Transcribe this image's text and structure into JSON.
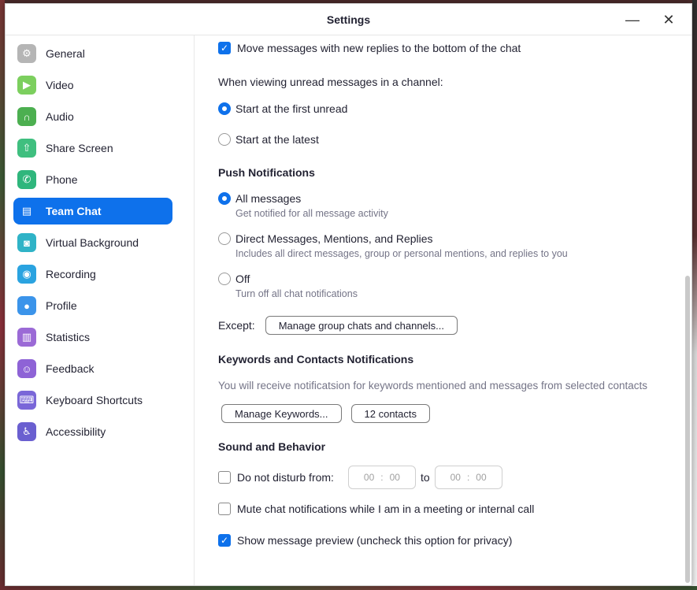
{
  "window": {
    "title": "Settings",
    "minimize_glyph": "—",
    "close_glyph": "✕"
  },
  "colors": {
    "accent": "#0e71eb",
    "muted": "#747487"
  },
  "sidebar": {
    "items": [
      {
        "label": "General",
        "icon": "gear-icon",
        "color": "#b5b5b5",
        "glyph": "⚙"
      },
      {
        "label": "Video",
        "icon": "video-camera-icon",
        "color": "#7ccf5e",
        "glyph": "▶"
      },
      {
        "label": "Audio",
        "icon": "headphones-icon",
        "color": "#4caf50",
        "glyph": "∩"
      },
      {
        "label": "Share Screen",
        "icon": "share-screen-icon",
        "color": "#3fbf7f",
        "glyph": "⇧"
      },
      {
        "label": "Phone",
        "icon": "phone-icon",
        "color": "#2fb67c",
        "glyph": "✆"
      },
      {
        "label": "Team Chat",
        "icon": "chat-bubble-icon",
        "color": "#0e71eb",
        "glyph": "▤"
      },
      {
        "label": "Virtual Background",
        "icon": "virtual-background-icon",
        "color": "#2fb3c7",
        "glyph": "◙"
      },
      {
        "label": "Recording",
        "icon": "recording-icon",
        "color": "#2aa3e0",
        "glyph": "◉"
      },
      {
        "label": "Profile",
        "icon": "profile-icon",
        "color": "#3b94ea",
        "glyph": "●"
      },
      {
        "label": "Statistics",
        "icon": "statistics-icon",
        "color": "#9b6ad6",
        "glyph": "▥"
      },
      {
        "label": "Feedback",
        "icon": "feedback-icon",
        "color": "#8e63d6",
        "glyph": "☺"
      },
      {
        "label": "Keyboard Shortcuts",
        "icon": "keyboard-icon",
        "color": "#7a67d8",
        "glyph": "⌨"
      },
      {
        "label": "Accessibility",
        "icon": "accessibility-icon",
        "color": "#6a5fd0",
        "glyph": "♿"
      }
    ],
    "active": "Team Chat"
  },
  "content": {
    "move_messages": {
      "label": "Move messages with new replies to the bottom of the chat",
      "checked": true
    },
    "unread_heading": "When viewing unread messages in a channel:",
    "unread_options": [
      {
        "label": "Start at the first unread",
        "checked": true
      },
      {
        "label": "Start at the latest",
        "checked": false
      }
    ],
    "push": {
      "heading": "Push Notifications",
      "options": [
        {
          "label": "All messages",
          "sub": "Get notified for all message activity",
          "checked": true
        },
        {
          "label": "Direct Messages, Mentions, and Replies",
          "sub": "Includes all direct messages, group or personal mentions, and replies to you",
          "checked": false
        },
        {
          "label": "Off",
          "sub": "Turn off all chat notifications",
          "checked": false
        }
      ],
      "except_label": "Except:",
      "manage_group_button": "Manage group chats and channels..."
    },
    "keywords": {
      "heading": "Keywords and Contacts Notifications",
      "description": "You will receive notificatsion for keywords mentioned and messages from selected contacts",
      "manage_keywords_button": "Manage Keywords...",
      "contacts_button": "12 contacts"
    },
    "sound": {
      "heading": "Sound and Behavior",
      "dnd_label": "Do not disturb from:",
      "dnd_from": {
        "hh": "00",
        "mm": "00"
      },
      "to_label": "to",
      "dnd_to": {
        "hh": "00",
        "mm": "00"
      },
      "time_separator": ":",
      "mute_label": "Mute chat notifications while I am in a meeting or internal call",
      "preview_label": "Show message preview (uncheck this option for privacy)",
      "dnd_checked": false,
      "mute_checked": false,
      "preview_checked": true
    }
  }
}
